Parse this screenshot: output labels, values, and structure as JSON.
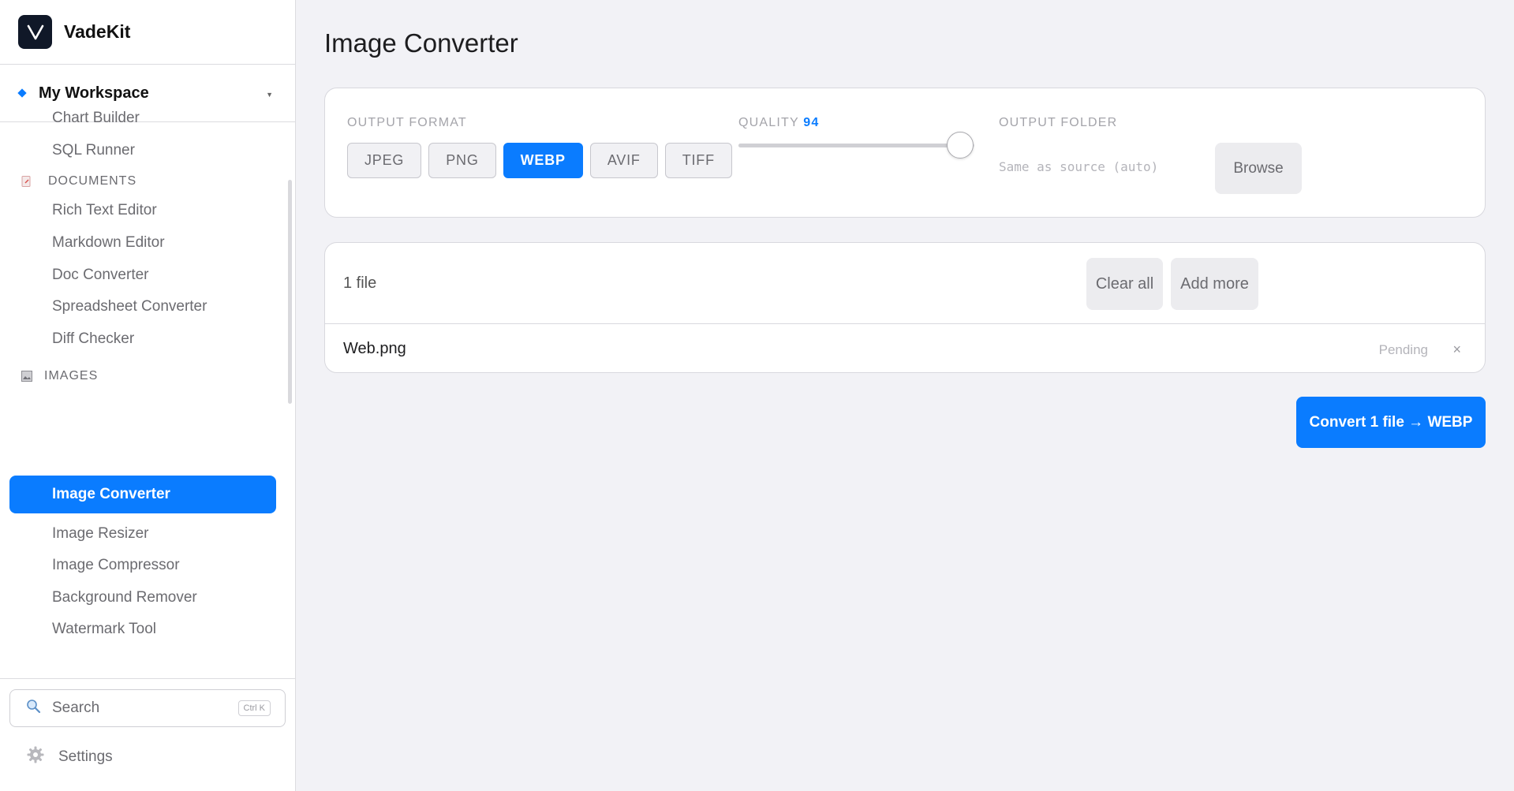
{
  "app": {
    "name": "VadeKit"
  },
  "workspace": {
    "name": "My Workspace"
  },
  "nav": {
    "top_items": [
      "Chart Builder",
      "SQL Runner"
    ],
    "documents": {
      "title": "DOCUMENTS",
      "items": [
        "Rich Text Editor",
        "Markdown Editor",
        "Doc Converter",
        "Spreadsheet Converter",
        "Diff Checker"
      ]
    },
    "images": {
      "title": "IMAGES",
      "active": "Image Converter",
      "items": [
        "Image Resizer",
        "Image Compressor",
        "Background Remover",
        "Watermark Tool"
      ]
    }
  },
  "sidebar_footer": {
    "search_label": "Search",
    "shortcut": "Ctrl K",
    "settings_label": "Settings"
  },
  "page": {
    "title": "Image Converter"
  },
  "options": {
    "format_label": "OUTPUT FORMAT",
    "formats": [
      "JPEG",
      "PNG",
      "WEBP",
      "AVIF",
      "TIFF"
    ],
    "selected_format": "WEBP",
    "quality_label": "QUALITY",
    "quality": "94",
    "quality_fraction": 0.94,
    "folder_label": "OUTPUT FOLDER",
    "folder_placeholder": "Same as source (auto)",
    "browse_label": "Browse"
  },
  "files": {
    "count_label": "1 file",
    "clear_label": "Clear all",
    "add_label": "Add more",
    "items": [
      {
        "name": "Web.png",
        "status": "Pending",
        "remove": "×"
      }
    ]
  },
  "convert_label": "Convert 1 file → WEBP",
  "colors": {
    "accent": "#0a7cff",
    "background": "#f2f2f6",
    "logo_bg": "#101828"
  }
}
